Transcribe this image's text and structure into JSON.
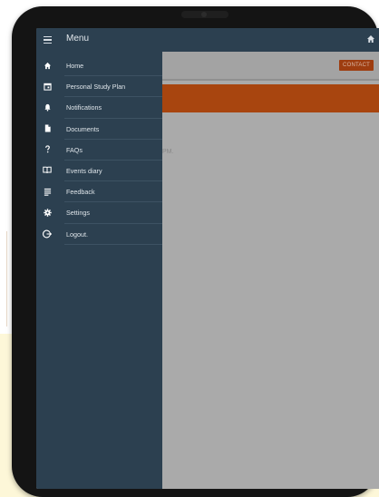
{
  "menu": {
    "title": "Menu",
    "items": [
      {
        "label": "Home",
        "icon": "home-icon"
      },
      {
        "label": "Personal Study Plan",
        "icon": "calendar-icon"
      },
      {
        "label": "Notifications",
        "icon": "bell-icon"
      },
      {
        "label": "Documents",
        "icon": "document-icon"
      },
      {
        "label": "FAQs",
        "icon": "question-icon"
      },
      {
        "label": "Events diary",
        "icon": "book-icon"
      },
      {
        "label": "Feedback",
        "icon": "feedback-icon"
      },
      {
        "label": "Settings",
        "icon": "gear-icon"
      },
      {
        "label": "Logout.",
        "icon": "logout-icon"
      }
    ]
  },
  "app": {
    "contact_label": "CONTACT",
    "faint_text": "PM."
  },
  "colors": {
    "drawer": "#2c4050",
    "accent": "#a8450f",
    "overlay": "#aaaaaa"
  }
}
